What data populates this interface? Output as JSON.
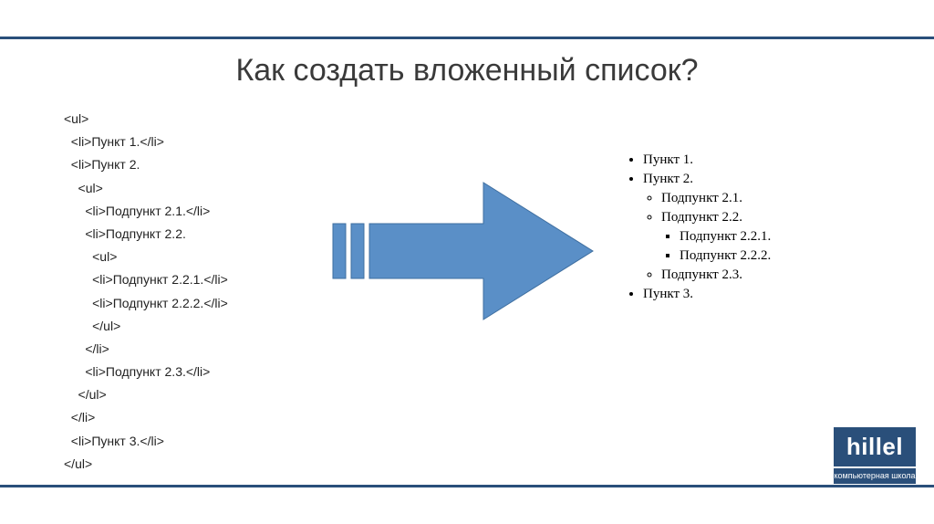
{
  "title": "Как создать вложенный список?",
  "code": [
    {
      "indent": 0,
      "text": "<ul>"
    },
    {
      "indent": 1,
      "text": "<li>Пункт 1.</li>"
    },
    {
      "indent": 1,
      "text": "<li>Пункт 2."
    },
    {
      "indent": 2,
      "text": "<ul>"
    },
    {
      "indent": 3,
      "text": "<li>Подпункт 2.1.</li>"
    },
    {
      "indent": 3,
      "text": "<li>Подпункт 2.2."
    },
    {
      "indent": 4,
      "text": "<ul>"
    },
    {
      "indent": 4,
      "text": "<li>Подпункт 2.2.1.</li>"
    },
    {
      "indent": 4,
      "text": "<li>Подпункт 2.2.2.</li>"
    },
    {
      "indent": 4,
      "text": "</ul>"
    },
    {
      "indent": 3,
      "text": "</li>"
    },
    {
      "indent": 3,
      "text": "<li>Подпункт 2.3.</li>"
    },
    {
      "indent": 2,
      "text": "</ul>"
    },
    {
      "indent": 1,
      "text": "</li>"
    },
    {
      "indent": 1,
      "text": "<li>Пункт 3.</li>"
    },
    {
      "indent": 0,
      "text": "</ul>"
    }
  ],
  "rendered": {
    "i1": "Пункт 1.",
    "i2": "Пункт 2.",
    "i2_1": "Подпункт 2.1.",
    "i2_2": "Подпункт 2.2.",
    "i2_2_1": "Подпункт 2.2.1.",
    "i2_2_2": "Подпункт 2.2.2.",
    "i2_3": "Подпункт 2.3.",
    "i3": "Пункт 3."
  },
  "logo": {
    "brand": "hillel",
    "tagline": "компьютерная школа"
  },
  "arrow_color": "#5a8fc7"
}
